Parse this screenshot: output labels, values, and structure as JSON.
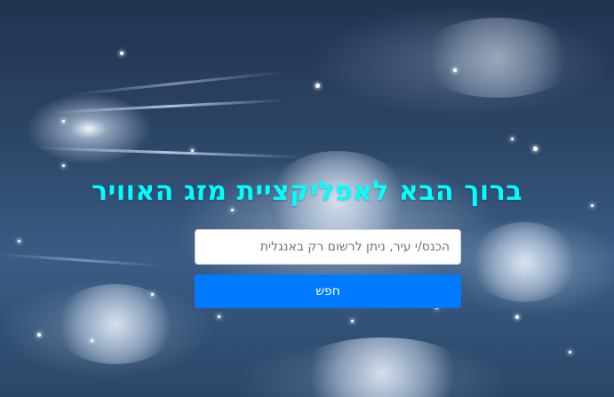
{
  "welcome": {
    "title": "ברוך הבא לאפליקציית מזג האוויר"
  },
  "search": {
    "placeholder": "הכנס/י עיר, ניתן לרשום רק באנגלית",
    "value": "",
    "button_label": "חפש"
  },
  "theme": {
    "title_color": "#00ffff",
    "button_color": "#007bff",
    "background": "night-sky-with-clouds"
  }
}
